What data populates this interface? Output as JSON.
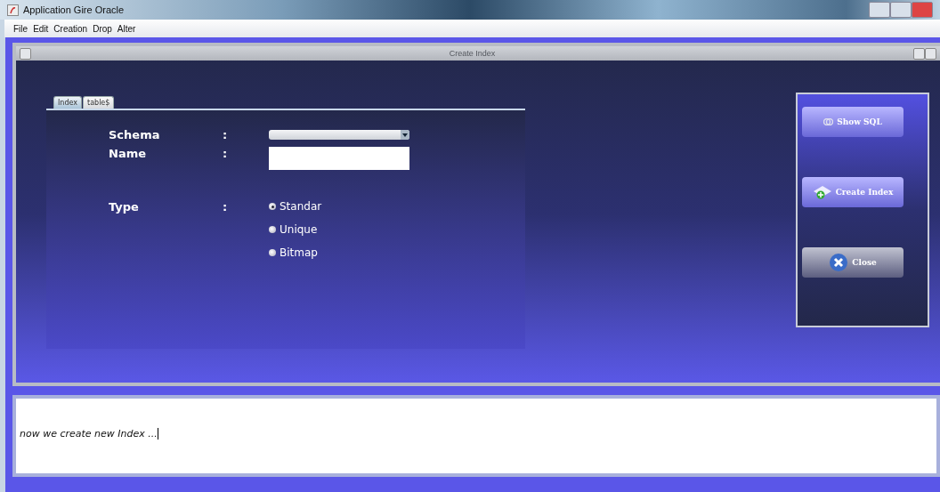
{
  "window": {
    "title": "Application Gire Oracle"
  },
  "menu": [
    "File",
    "Edit",
    "Creation",
    "Drop",
    "Alter"
  ],
  "frame": {
    "title": "Create Index"
  },
  "tabs": [
    {
      "label": "Index",
      "selected": true
    },
    {
      "label": "table$",
      "selected": false
    }
  ],
  "form": {
    "schema_label": "Schema",
    "name_label": "Name",
    "type_label": "Type",
    "separators": [
      ":",
      ":",
      ":"
    ],
    "types": [
      {
        "label": "Standar",
        "selected": true
      },
      {
        "label": "Unique",
        "selected": false
      },
      {
        "label": "Bitmap",
        "selected": false
      }
    ]
  },
  "buttons": [
    {
      "label": "Show SQL",
      "kind": "sql"
    },
    {
      "label": "Create Index",
      "kind": "create"
    },
    {
      "label": "Close",
      "kind": "close"
    }
  ],
  "log": {
    "text": "now we create new Index ..."
  }
}
